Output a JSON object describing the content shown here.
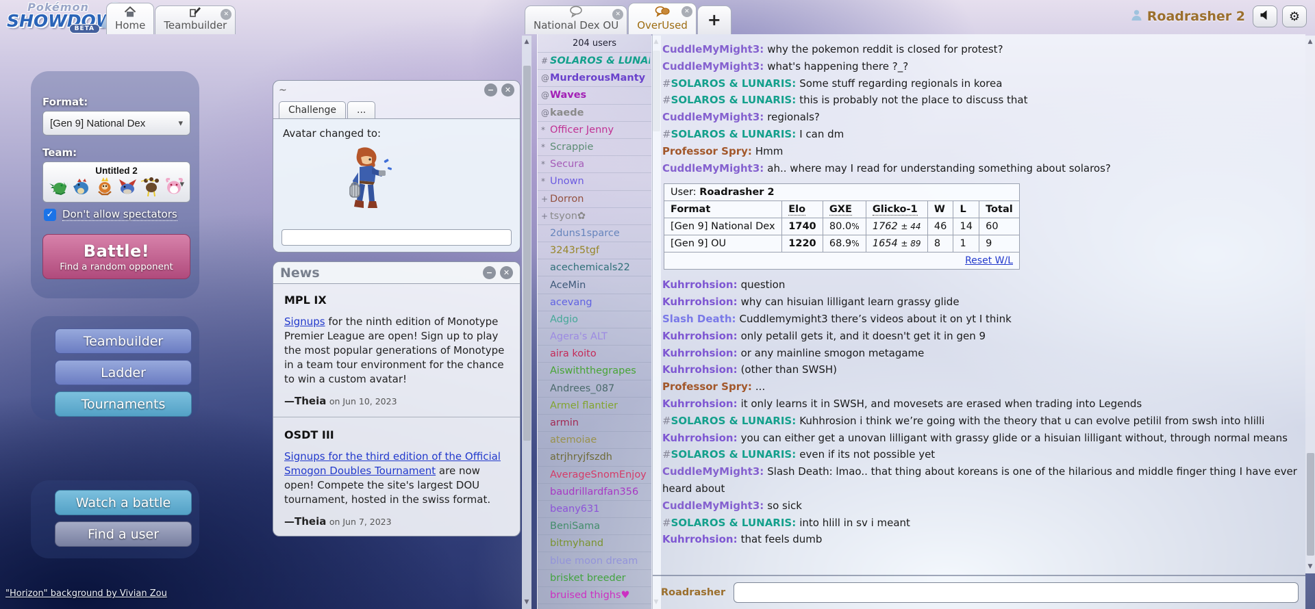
{
  "topbar": {
    "logo_top": "Pokémon",
    "logo_main": "SHOWDOWN",
    "logo_beta": "BETA",
    "home_tab": "Home",
    "teambuilder_tab": "Teambuilder",
    "natdex_tab": "National Dex OU",
    "overused_tab": "OverUsed",
    "add_tab": "+",
    "username": "Roadrasher 2"
  },
  "icons": {
    "minimize": "−",
    "close": "✕",
    "caret_down": "▾",
    "check": "✓",
    "gear": "⚙",
    "arrow_up": "▲",
    "arrow_down": "▼"
  },
  "home": {
    "format_label": "Format:",
    "format_value": "[Gen 9] National Dex",
    "team_label": "Team:",
    "team_name": "Untitled 2",
    "spectators_label": "Don't allow spectators",
    "battle_title": "Battle!",
    "battle_subtitle": "Find a random opponent",
    "btn_teambuilder": "Teambuilder",
    "btn_ladder": "Ladder",
    "btn_tournaments": "Tournaments",
    "btn_watch": "Watch a battle",
    "btn_finduser": "Find a user",
    "credit": "\"Horizon\" background by Vivian Zou"
  },
  "challenge_window": {
    "title": "~",
    "tab_challenge": "Challenge",
    "tab_more": "...",
    "message": "Avatar changed to:",
    "input_value": ""
  },
  "news": {
    "title": "News",
    "articles": [
      {
        "heading": "MPL IX",
        "link": "Signups",
        "body": " for the ninth edition of Monotype Premier League are open! Sign up to play the most popular generations of Monotype in a team tour environment for the chance to win a custom avatar!",
        "author": "—Theia",
        "date": "on Jun 10, 2023"
      },
      {
        "heading": "OSDT III",
        "link": "Signups for the third edition of the Official Smogon Doubles Tournament",
        "body": " are now open! Compete the site's largest DOU tournament, hosted in the swiss format.",
        "author": "—Theia",
        "date": "on Jun 7, 2023"
      }
    ]
  },
  "userlist": {
    "count": "204 users",
    "users": [
      {
        "rank": "#",
        "name": "SOLAROS & LUNARIS",
        "color": "#14a08c",
        "cls": "bold italic"
      },
      {
        "rank": "@",
        "name": "MurderousManty",
        "color": "#6a42cc",
        "cls": "bold"
      },
      {
        "rank": "@",
        "name": "Waves",
        "color": "#a21fb5",
        "cls": "bold"
      },
      {
        "rank": "@",
        "name": "kaede",
        "color": "#8a8a8a",
        "cls": "bold"
      },
      {
        "rank": "*",
        "name": "Officer Jenny",
        "color": "#c03093",
        "cls": ""
      },
      {
        "rank": "*",
        "name": "Scrappie",
        "color": "#5d8d74",
        "cls": ""
      },
      {
        "rank": "*",
        "name": "Secura",
        "color": "#a55cb8",
        "cls": ""
      },
      {
        "rank": "*",
        "name": "Unown",
        "color": "#6a5ae0",
        "cls": ""
      },
      {
        "rank": "+",
        "name": "Dorron",
        "color": "#93513f",
        "cls": ""
      },
      {
        "rank": "+",
        "name": "tsyon✿",
        "color": "#8a8a8a",
        "cls": ""
      },
      {
        "rank": "",
        "name": "2duns1sparce",
        "color": "#6684bc",
        "cls": ""
      },
      {
        "rank": "",
        "name": "3243r5tgf",
        "color": "#97862a",
        "cls": ""
      },
      {
        "rank": "",
        "name": "acechemicals22",
        "color": "#2f6f78",
        "cls": ""
      },
      {
        "rank": "",
        "name": "AceMin",
        "color": "#3d5878",
        "cls": ""
      },
      {
        "rank": "",
        "name": "acevang",
        "color": "#6062e2",
        "cls": ""
      },
      {
        "rank": "",
        "name": "Adgio",
        "color": "#46a898",
        "cls": ""
      },
      {
        "rank": "",
        "name": "Agera's ALT",
        "color": "#9c8ae2",
        "cls": ""
      },
      {
        "rank": "",
        "name": "aira koito",
        "color": "#c42a58",
        "cls": ""
      },
      {
        "rank": "",
        "name": "Aiswiththegrapes",
        "color": "#48a435",
        "cls": ""
      },
      {
        "rank": "",
        "name": "Andrees_087",
        "color": "#4b6a6c",
        "cls": ""
      },
      {
        "rank": "",
        "name": "Armel flantier",
        "color": "#82a430",
        "cls": ""
      },
      {
        "rank": "",
        "name": "armin",
        "color": "#a12a54",
        "cls": ""
      },
      {
        "rank": "",
        "name": "atemoiae",
        "color": "#99914c",
        "cls": ""
      },
      {
        "rank": "",
        "name": "atrjhryjfszdh",
        "color": "#6f6b39",
        "cls": ""
      },
      {
        "rank": "",
        "name": "AverageSnomEnjoy",
        "color": "#d43c68",
        "cls": ""
      },
      {
        "rank": "",
        "name": "baudrillardfan356",
        "color": "#a738c4",
        "cls": ""
      },
      {
        "rank": "",
        "name": "beany631",
        "color": "#8d53d8",
        "cls": ""
      },
      {
        "rank": "",
        "name": "BeniSama",
        "color": "#438d6b",
        "cls": ""
      },
      {
        "rank": "",
        "name": "bitmyhand",
        "color": "#7a932f",
        "cls": ""
      },
      {
        "rank": "",
        "name": "blue moon dream",
        "color": "#9394da",
        "cls": ""
      },
      {
        "rank": "",
        "name": "brisket breeder",
        "color": "#43a340",
        "cls": ""
      },
      {
        "rank": "",
        "name": "bruised thighs♥",
        "color": "#cc30c2",
        "cls": ""
      }
    ]
  },
  "chat": {
    "messages_before": [
      {
        "rank": "",
        "user": "CuddleMyMight3",
        "color": "#8561cf",
        "text": "why the pokemon reddit is closed for protest?"
      },
      {
        "rank": "",
        "user": "CuddleMyMight3",
        "color": "#8561cf",
        "text": "what's happening there ?_?"
      },
      {
        "rank": "#",
        "user": "SOLAROS & LUNARIS",
        "color": "#14a08c",
        "text": "Some stuff regarding regionals in korea"
      },
      {
        "rank": "#",
        "user": "SOLAROS & LUNARIS",
        "color": "#14a08c",
        "text": "this is probably not the place to discuss that"
      },
      {
        "rank": "",
        "user": "CuddleMyMight3",
        "color": "#8561cf",
        "text": "regionals?"
      },
      {
        "rank": "#",
        "user": "SOLAROS & LUNARIS",
        "color": "#14a08c",
        "text": "I can dm"
      },
      {
        "rank": "",
        "user": "Professor Spry",
        "color": "#a2572a",
        "text": "Hmm"
      },
      {
        "rank": "",
        "user": "CuddleMyMight3",
        "color": "#8561cf",
        "text": "ah.. where may I read for understanding something about solaros?"
      }
    ],
    "table": {
      "user_label": "User:",
      "user_name": "Roadrasher 2",
      "h_format": "Format",
      "h_elo": "Elo",
      "h_gxe": "GXE",
      "h_glicko": "Glicko-1",
      "h_w": "W",
      "h_l": "L",
      "h_total": "Total",
      "rows": [
        {
          "format": "[Gen 9] National Dex",
          "elo": "1740",
          "gxe": "80.0",
          "pct": "%",
          "glicko": "1762",
          "dev": "± 44",
          "w": "46",
          "l": "14",
          "total": "60"
        },
        {
          "format": "[Gen 9] OU",
          "elo": "1220",
          "gxe": "68.9",
          "pct": "%",
          "glicko": "1654",
          "dev": "± 89",
          "w": "8",
          "l": "1",
          "total": "9"
        }
      ],
      "reset": "Reset W/L"
    },
    "messages_after": [
      {
        "rank": "",
        "user": "Kuhrrohsion",
        "color": "#7e57d2",
        "text": "question"
      },
      {
        "rank": "",
        "user": "Kuhrrohsion",
        "color": "#7e57d2",
        "text": "why can hisuian lilligant learn grassy glide"
      },
      {
        "rank": "",
        "user": "Slash Death",
        "color": "#7a79e8",
        "text": "Cuddlemymight3 there’s videos about it on yt I think"
      },
      {
        "rank": "",
        "user": "Kuhrrohsion",
        "color": "#7e57d2",
        "text": "only petalil gets it, and it doesn't get it in gen 9"
      },
      {
        "rank": "",
        "user": "Kuhrrohsion",
        "color": "#7e57d2",
        "text": "or any mainline smogon metagame"
      },
      {
        "rank": "",
        "user": "Kuhrrohsion",
        "color": "#7e57d2",
        "text": "(other than SWSH)"
      },
      {
        "rank": "",
        "user": "Professor Spry",
        "color": "#a2572a",
        "text": "..."
      },
      {
        "rank": "",
        "user": "Kuhrrohsion",
        "color": "#7e57d2",
        "text": "it only learns it in SWSH, and movesets are erased when trading into Legends"
      },
      {
        "rank": "#",
        "user": "SOLAROS & LUNARIS",
        "color": "#14a08c",
        "text": "Kuhhrosion i think we’re going with the theory that u can evolve petilil from swsh into hlilli"
      },
      {
        "rank": "",
        "user": "Kuhrrohsion",
        "color": "#7e57d2",
        "text": "you can either get a unovan lilligant with grassy glide or a hisuian lilligant without, through normal means"
      },
      {
        "rank": "#",
        "user": "SOLAROS & LUNARIS",
        "color": "#14a08c",
        "text": "even if its not possible yet"
      },
      {
        "rank": "",
        "user": "CuddleMyMight3",
        "color": "#8561cf",
        "text": "Slash Death: lmao.. that thing about koreans is one of the hilarious and middle finger thing I have ever heard about"
      },
      {
        "rank": "",
        "user": "CuddleMyMight3",
        "color": "#8561cf",
        "text": "so sick"
      },
      {
        "rank": "#",
        "user": "SOLAROS & LUNARIS",
        "color": "#14a08c",
        "text": "into hlill in sv i meant"
      },
      {
        "rank": "",
        "user": "Kuhrrohsion",
        "color": "#7e57d2",
        "text": "that feels dumb"
      }
    ],
    "input_label": "Roadrasher",
    "input_value": ""
  }
}
